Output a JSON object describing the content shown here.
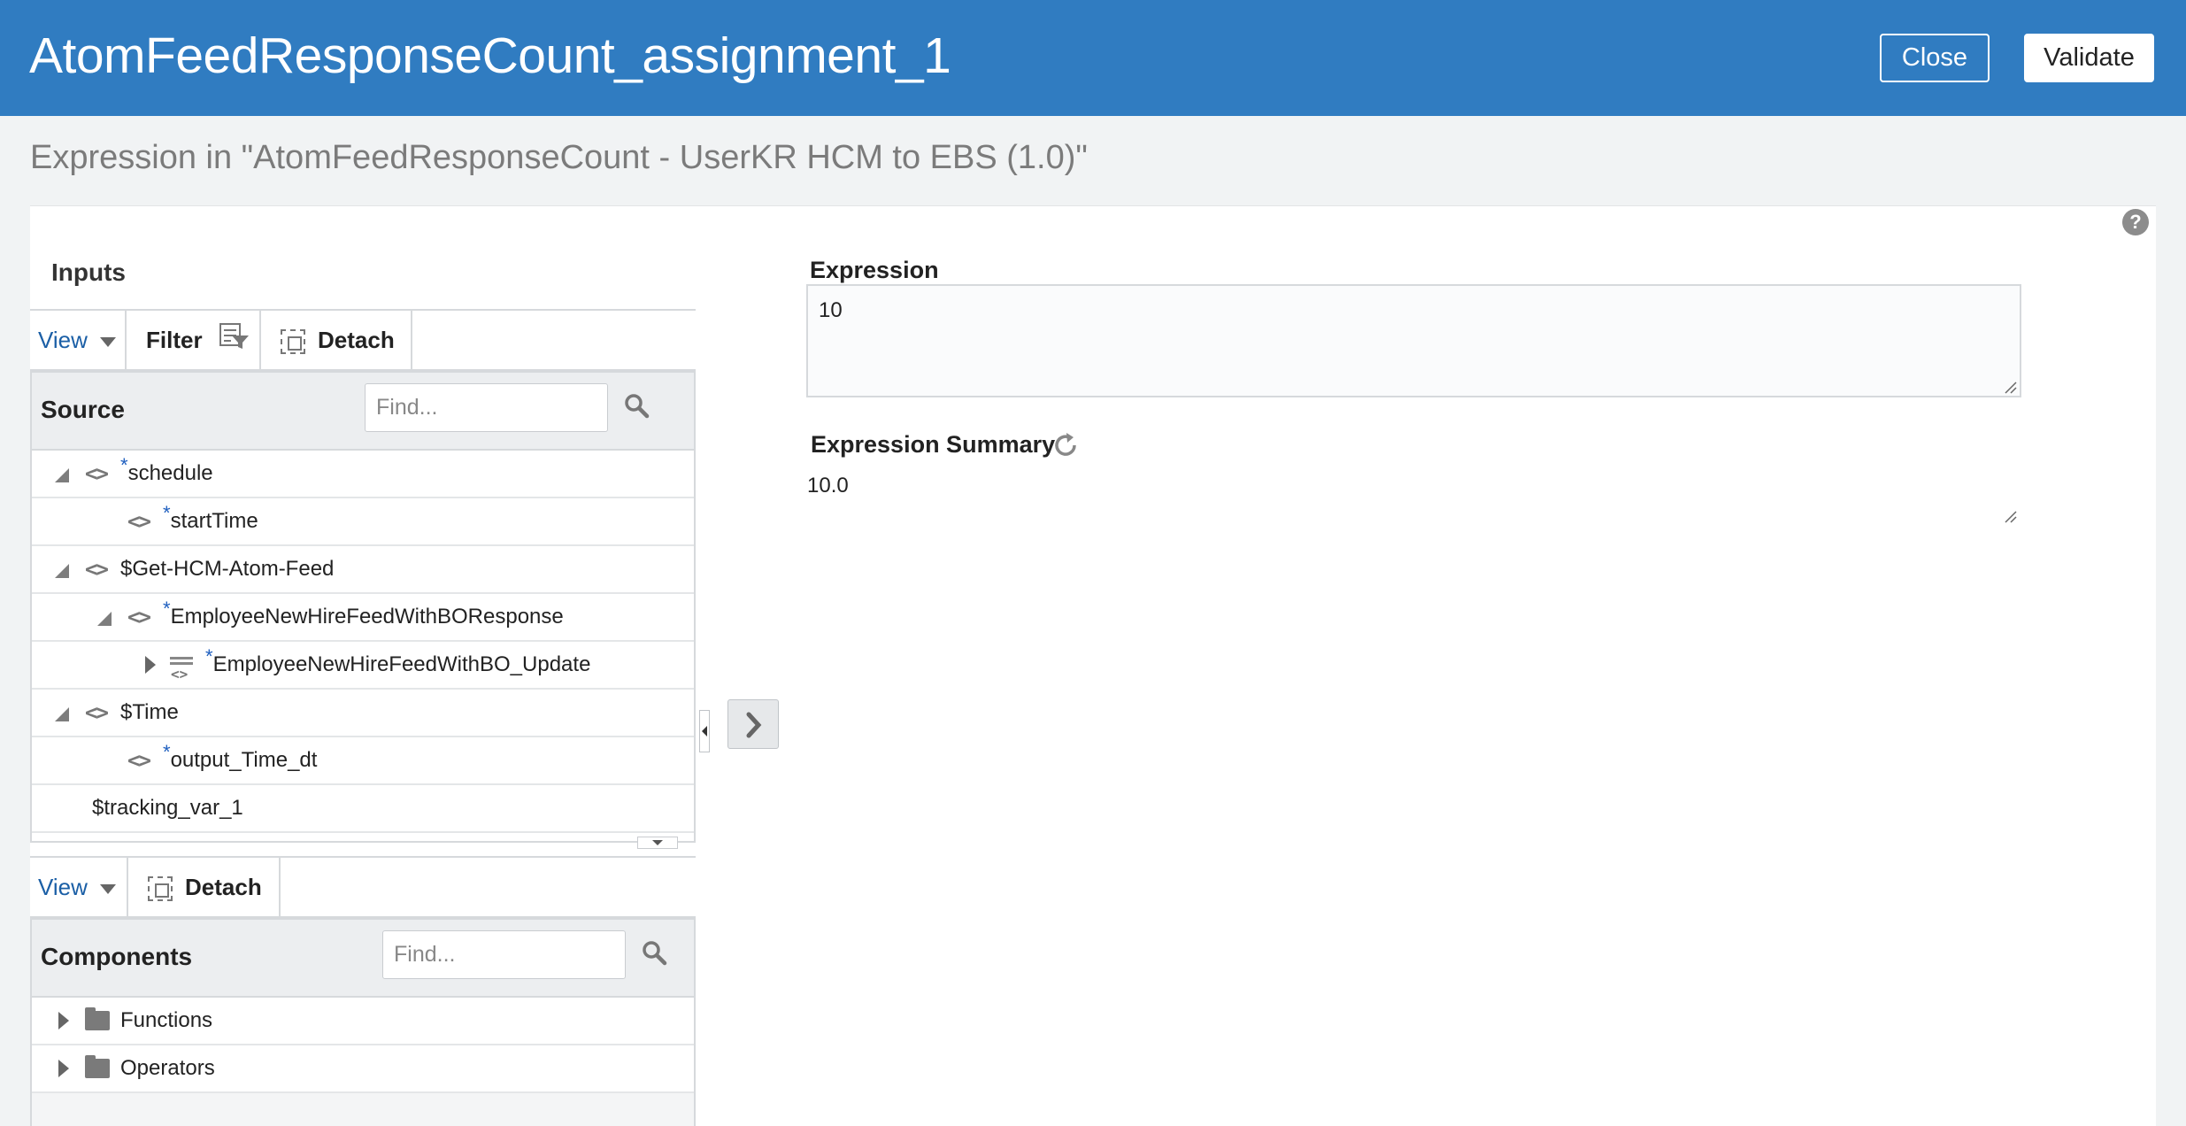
{
  "header": {
    "title": "AtomFeedResponseCount_assignment_1",
    "close_label": "Close",
    "validate_label": "Validate",
    "bg_color": "#307cc1"
  },
  "subtitle": "Expression in \"AtomFeedResponseCount - UserKR HCM to EBS (1.0)\"",
  "inputs": {
    "label": "Inputs",
    "toolbar": {
      "view_label": "View",
      "filter_label": "Filter",
      "detach_label": "Detach"
    },
    "source": {
      "title": "Source",
      "find_placeholder": "Find...",
      "rows": [
        {
          "label": "schedule",
          "required": true,
          "expanded": true,
          "icon": "code-icon"
        },
        {
          "label": "startTime",
          "required": true,
          "icon": "code-icon"
        },
        {
          "label": "$Get-HCM-Atom-Feed",
          "required": false,
          "expanded": true,
          "icon": "code-icon"
        },
        {
          "label": "EmployeeNewHireFeedWithBOResponse",
          "required": true,
          "expanded": true,
          "icon": "code-icon"
        },
        {
          "label": "EmployeeNewHireFeedWithBO_Update",
          "required": true,
          "expanded": false,
          "icon": "repeating-element-icon"
        },
        {
          "label": "$Time",
          "required": false,
          "expanded": true,
          "icon": "code-icon"
        },
        {
          "label": "output_Time_dt",
          "required": true,
          "icon": "code-icon"
        },
        {
          "label": "$tracking_var_1",
          "required": false
        }
      ],
      "required_marker": "*"
    }
  },
  "components": {
    "toolbar": {
      "view_label": "View",
      "detach_label": "Detach"
    },
    "title": "Components",
    "find_placeholder": "Find...",
    "rows": [
      {
        "label": "Functions",
        "icon": "folder-icon"
      },
      {
        "label": "Operators",
        "icon": "folder-icon"
      }
    ]
  },
  "expression": {
    "label": "Expression",
    "value": "10",
    "summary_label": "Expression Summary",
    "summary_value": "10.0"
  },
  "help_icon_text": "?"
}
